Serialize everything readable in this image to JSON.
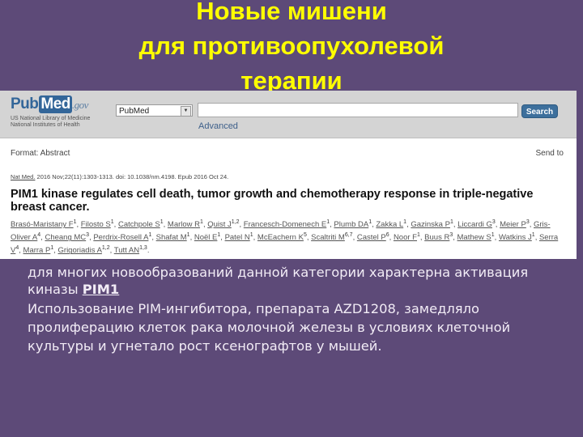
{
  "slide": {
    "title_lines": [
      "Новые мишени",
      "для противоопухолевой",
      "терапии"
    ],
    "title_color": "#ffff00",
    "background_color": "#5d4a78"
  },
  "pubmed": {
    "logo": {
      "pub": "Pub",
      "med": "Med",
      "gov": ".gov",
      "sub_line1": "US National Library of Medicine",
      "sub_line2": "National Institutes of Health"
    },
    "db_select_value": "PubMed",
    "search_input_value": "",
    "search_button_label": "Search",
    "advanced_link": "Advanced",
    "format_label": "Format: Abstract",
    "send_to_label": "Send to",
    "citation": {
      "journal": "Nat Med.",
      "details": " 2016 Nov;22(11):1303-1313. doi: 10.1038/nm.4198. Epub 2016 Oct 24."
    },
    "article_title": "PIM1 kinase regulates cell death, tumor growth and chemotherapy response in triple-negative breast cancer.",
    "authors": [
      {
        "name": "Brasó-Maristany F",
        "aff": "1"
      },
      {
        "name": "Filosto S",
        "aff": "1"
      },
      {
        "name": "Catchpole S",
        "aff": "1"
      },
      {
        "name": "Marlow R",
        "aff": "1"
      },
      {
        "name": "Quist J",
        "aff": "1,2"
      },
      {
        "name": "Francesch-Domenech E",
        "aff": "1"
      },
      {
        "name": "Plumb DA",
        "aff": "1"
      },
      {
        "name": "Zakka L",
        "aff": "1"
      },
      {
        "name": "Gazinska P",
        "aff": "1"
      },
      {
        "name": "Liccardi G",
        "aff": "3"
      },
      {
        "name": "Meier P",
        "aff": "3"
      },
      {
        "name": "Gris-Oliver A",
        "aff": "4"
      },
      {
        "name": "Cheang MC",
        "aff": "3"
      },
      {
        "name": "Perdrix-Rosell A",
        "aff": "1"
      },
      {
        "name": "Shafat M",
        "aff": "1"
      },
      {
        "name": "Noël E",
        "aff": "1"
      },
      {
        "name": "Patel N",
        "aff": "1"
      },
      {
        "name": "McEachern K",
        "aff": "5"
      },
      {
        "name": "Scaltriti M",
        "aff": "6,7"
      },
      {
        "name": "Castel P",
        "aff": "6"
      },
      {
        "name": "Noor F",
        "aff": "1"
      },
      {
        "name": "Buus R",
        "aff": "3"
      },
      {
        "name": "Mathew S",
        "aff": "1"
      },
      {
        "name": "Watkins J",
        "aff": "1"
      },
      {
        "name": "Serra V",
        "aff": "4"
      },
      {
        "name": "Marra P",
        "aff": "1"
      },
      {
        "name": "Grigoriadis A",
        "aff": "1,2"
      },
      {
        "name": "Tutt AN",
        "aff": "1,3"
      }
    ]
  },
  "body": {
    "para1_text": "для многих новообразований данной категории характерна активация киназы ",
    "para1_link": "PIM1",
    "para2_text": "Использование PIM-ингибитора, препарата AZD1208, замедляло пролиферацию клеток рака молочной железы в условиях клеточной культуры и угнетало рост ксенографтов у мышей."
  }
}
